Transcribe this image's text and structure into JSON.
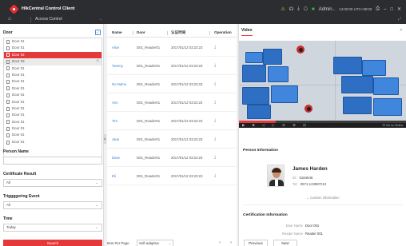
{
  "app": {
    "title": "HikCentral Control Client",
    "module": "Access Control"
  },
  "topbar": {
    "user": "Admin",
    "time": "14:00:00 UTC+08:00"
  },
  "sidebar": {
    "door_label": "Door",
    "doors": [
      "Door 01",
      "Door 01",
      "Door 02",
      "Door 03",
      "Door 01",
      "Door 01",
      "Door 01",
      "Door 01",
      "Door 01",
      "Door 01",
      "Door 01",
      "Door 01",
      "Door 01",
      "Door 01",
      "Door 01",
      "Door 01",
      "Door 01",
      "Door 01"
    ],
    "selected_index": 2,
    "hover_index": 3,
    "person_name_label": "Person Name",
    "person_name_value": "",
    "cert_result_label": "Certificate Result",
    "cert_result_value": "All",
    "trigger_event_label": "Triggggering Event",
    "trigger_event_value": "All",
    "time_label": "Time",
    "time_value": "Today",
    "search_label": "Search"
  },
  "table": {
    "headers": {
      "name": "Name",
      "door": "Door",
      "time": "认证时间",
      "op": "Operation"
    },
    "rows": [
      {
        "name": "Alice",
        "door": "D01_Reader01",
        "time": "2017/01/12 03:23:23"
      },
      {
        "name": "Tommy",
        "door": "D01_Reader01",
        "time": "2017/01/12 03:23:23"
      },
      {
        "name": "No Name",
        "door": "D01_Reader01",
        "time": "2017/01/12 03:23:23"
      },
      {
        "name": "Ann",
        "door": "D01_Reader01",
        "time": "2017/01/12 03:23:23"
      },
      {
        "name": "Tim",
        "door": "D01_Reader01",
        "time": "2017/01/12 03:23:23"
      },
      {
        "name": "Jane",
        "door": "D01_Reader01",
        "time": "2017/01/12 03:23:23"
      },
      {
        "name": "Dave",
        "door": "D01_Reader01",
        "time": "2017/01/12 03:23:23"
      },
      {
        "name": "Eli",
        "door": "D01_Reader01",
        "time": "2017/01/12 03:23:23"
      }
    ],
    "items_per_page_label": "Item Per Page",
    "items_per_page_value": "Self-adaptive"
  },
  "video": {
    "tab_label": "Video",
    "goto_label": "Go to Video",
    "progress": 0.22
  },
  "person_info": {
    "title": "Person Information",
    "name": "James Harden",
    "id_label": "ID:",
    "id_value": "5184646",
    "tel_label": "Tel:",
    "tel_value": "0571-123987213",
    "custom_info": "Custom Information"
  },
  "cert_info": {
    "title": "Certification Information",
    "door_name_label": "Door Name",
    "door_name_value": "Door 001",
    "reader_name_label": "Reader Name",
    "reader_name_value": "Reader 001"
  },
  "nav": {
    "previous": "Previous",
    "next": "Next"
  },
  "colors": {
    "accent": "#e5383b",
    "link": "#3b7bd3",
    "box": "#2e6fc4"
  }
}
